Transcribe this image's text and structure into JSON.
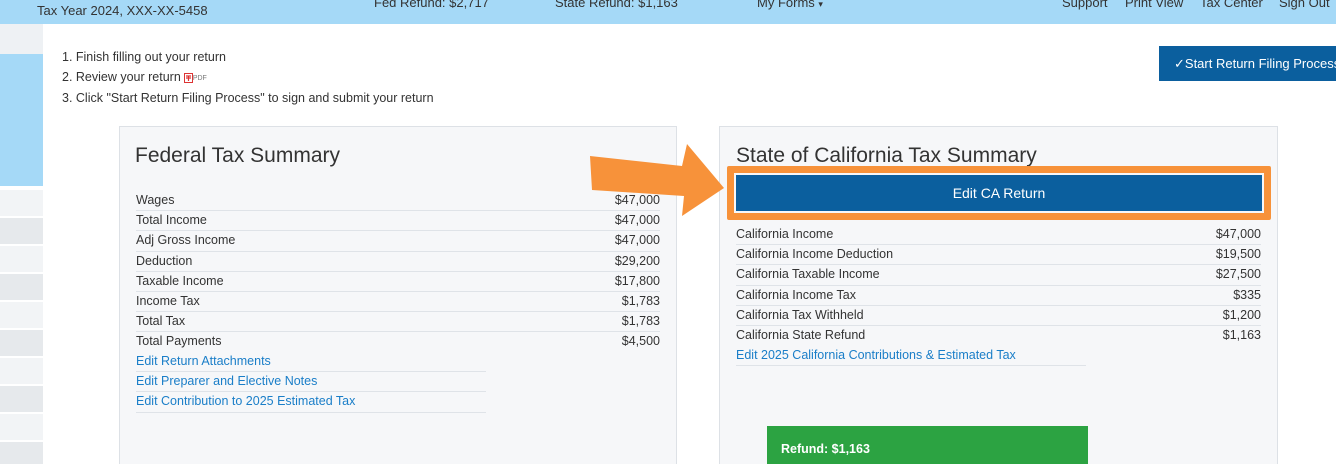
{
  "topbar": {
    "tax_year": "Tax Year 2024, XXX-XX-5458",
    "fed_refund": "Fed Refund: $2,717",
    "state_refund": "State Refund: $1,163",
    "my_forms": "My Forms",
    "support": "Support",
    "print_view": "Print View",
    "tax_center": "Tax Center",
    "sign_out": "Sign Out"
  },
  "steps": [
    "1. Finish filling out your return",
    "2. Review your return",
    "3. Click \"Start Return Filing Process\" to sign and submit your return"
  ],
  "pdf_label": "PDF",
  "filing_button": "✓Start Return Filing Process",
  "federal": {
    "title": "Federal Tax Summary",
    "rows": [
      {
        "label": "Wages",
        "value": "$47,000"
      },
      {
        "label": "Total Income",
        "value": "$47,000"
      },
      {
        "label": "Adj Gross Income",
        "value": "$47,000"
      },
      {
        "label": "Deduction",
        "value": "$29,200"
      },
      {
        "label": "Taxable Income",
        "value": "$17,800"
      },
      {
        "label": "Income Tax",
        "value": "$1,783"
      },
      {
        "label": "Total Tax",
        "value": "$1,783"
      },
      {
        "label": "Total Payments",
        "value": "$4,500"
      }
    ],
    "links": [
      "Edit Return Attachments",
      "Edit Preparer and Elective Notes",
      "Edit Contribution to 2025 Estimated Tax"
    ]
  },
  "state": {
    "title": "State of California Tax Summary",
    "edit_button": "Edit CA Return",
    "rows": [
      {
        "label": "California Income",
        "value": "$47,000"
      },
      {
        "label": "California Income Deduction",
        "value": "$19,500"
      },
      {
        "label": "California Taxable Income",
        "value": "$27,500"
      },
      {
        "label": "California Income Tax",
        "value": "$335"
      },
      {
        "label": "California Tax Withheld",
        "value": "$1,200"
      },
      {
        "label": "California State Refund",
        "value": "$1,163"
      }
    ],
    "links": [
      "Edit 2025 California Contributions & Estimated Tax"
    ],
    "refund_box": "Refund: $1,163"
  },
  "colors": {
    "topbar": "#a5d9f7",
    "primary_button": "#0b5f9e",
    "highlight": "#f7923a",
    "refund_green": "#2ca342",
    "link": "#1a7ec8"
  }
}
